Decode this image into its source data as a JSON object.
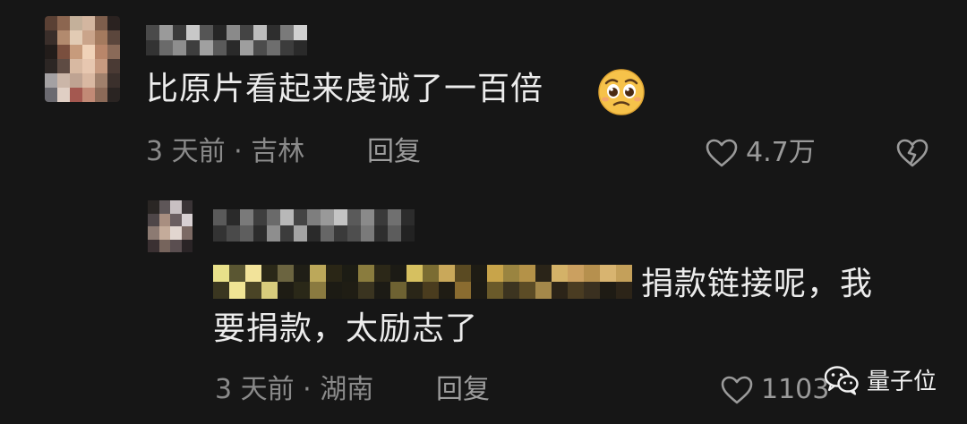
{
  "comments": [
    {
      "text": "比原片看起来虔诚了一百倍",
      "emoji": "pleading-face-emoji",
      "meta": "3 天前 · 吉林",
      "reply_label": "回复",
      "likes": "4.7万"
    }
  ],
  "reply": {
    "text_line1": "捐款链接呢，我",
    "text_line2": "要捐款，太励志了",
    "meta": "3 天前 · 湖南",
    "reply_label": "回复",
    "likes": "1103"
  },
  "icons": {
    "like": "heart-outline-icon",
    "dislike": "broken-heart-icon",
    "watermark": "wechat-icon"
  },
  "watermark": "量子位",
  "colors": {
    "background": "#161616",
    "text": "#ececec",
    "meta": "#8a8a8a"
  }
}
